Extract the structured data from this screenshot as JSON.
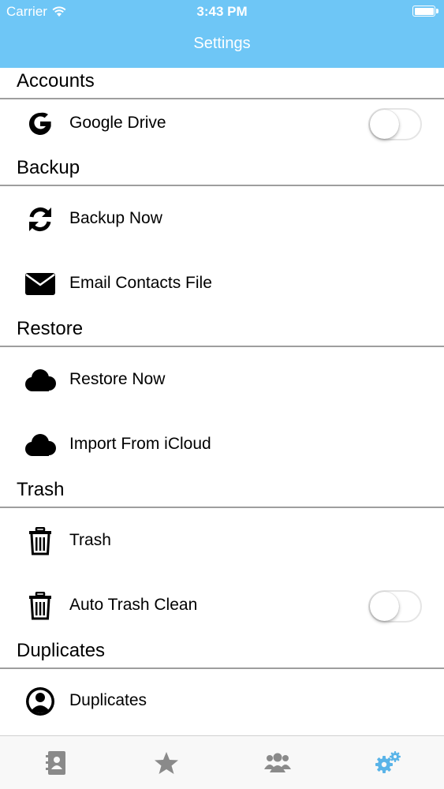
{
  "status_bar": {
    "carrier": "Carrier",
    "time": "3:43 PM",
    "battery_level": 1.0
  },
  "nav": {
    "title": "Settings"
  },
  "colors": {
    "header_bg": "#6ec6f6",
    "tab_active": "#5ab4e8",
    "tab_inactive": "#8a8a8a",
    "divider": "#9e9e9e"
  },
  "sections": [
    {
      "title": "Accounts",
      "rows": [
        {
          "label": "Google Drive",
          "icon": "google-icon",
          "toggle": false
        }
      ]
    },
    {
      "title": "Backup",
      "rows": [
        {
          "label": "Backup Now",
          "icon": "sync-icon"
        },
        {
          "label": "Email Contacts File",
          "icon": "envelope-icon"
        }
      ]
    },
    {
      "title": "Restore",
      "rows": [
        {
          "label": "Restore Now",
          "icon": "cloud-icon"
        },
        {
          "label": "Import From iCloud",
          "icon": "cloud-icon"
        }
      ]
    },
    {
      "title": "Trash",
      "rows": [
        {
          "label": "Trash",
          "icon": "trash-icon"
        },
        {
          "label": "Auto Trash Clean",
          "icon": "trash-icon",
          "toggle": false
        }
      ]
    },
    {
      "title": "Duplicates",
      "rows": [
        {
          "label": "Duplicates",
          "icon": "user-circle-icon"
        }
      ]
    }
  ],
  "tabs": [
    {
      "icon": "contacts-book-icon",
      "active": false
    },
    {
      "icon": "star-icon",
      "active": false
    },
    {
      "icon": "group-icon",
      "active": false
    },
    {
      "icon": "gears-icon",
      "active": true
    }
  ]
}
